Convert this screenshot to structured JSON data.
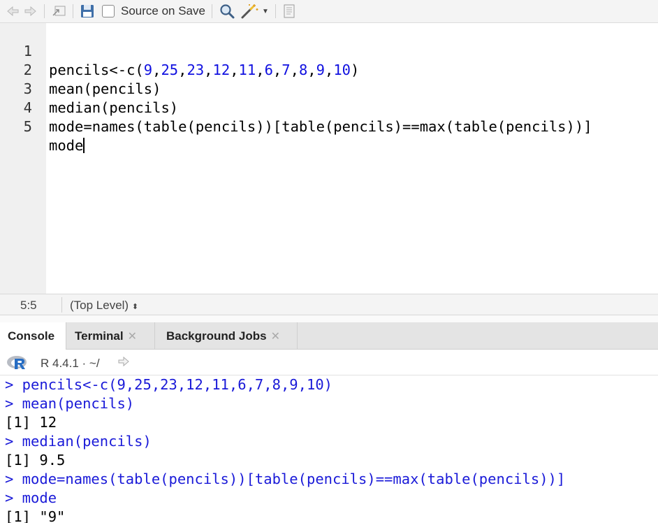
{
  "toolbar": {
    "source_on_save_label": "Source on Save"
  },
  "editor": {
    "lines": [
      {
        "num": "1",
        "text": "pencils<-c(9,25,23,12,11,6,7,8,9,10)"
      },
      {
        "num": "2",
        "text": "mean(pencils)"
      },
      {
        "num": "3",
        "text": "median(pencils)"
      },
      {
        "num": "4",
        "text": "mode=names(table(pencils))[table(pencils)==max(table(pencils))]"
      },
      {
        "num": "5",
        "text": "mode"
      }
    ]
  },
  "status": {
    "position": "5:5",
    "scope": "(Top Level)"
  },
  "tabs": [
    {
      "label": "Console",
      "active": true
    },
    {
      "label": "Terminal",
      "active": false
    },
    {
      "label": "Background Jobs",
      "active": false
    }
  ],
  "console_header": {
    "version": "R 4.4.1 · ~/"
  },
  "console": {
    "lines": [
      {
        "type": "cmd",
        "text": "> pencils<-c(9,25,23,12,11,6,7,8,9,10)"
      },
      {
        "type": "cmd",
        "text": "> mean(pencils)"
      },
      {
        "type": "out",
        "text": "[1] 12"
      },
      {
        "type": "cmd",
        "text": "> median(pencils)"
      },
      {
        "type": "out",
        "text": "[1] 9.5"
      },
      {
        "type": "cmd",
        "text": "> mode=names(table(pencils))[table(pencils)==max(table(pencils))]"
      },
      {
        "type": "cmd",
        "text": "> mode"
      },
      {
        "type": "out",
        "text": "[1] \"9\""
      }
    ]
  },
  "colors": {
    "number": "#1010e0",
    "console_command": "#1a1ad8",
    "gutter": "#f0f0f0",
    "toolbar": "#f4f4f4"
  }
}
